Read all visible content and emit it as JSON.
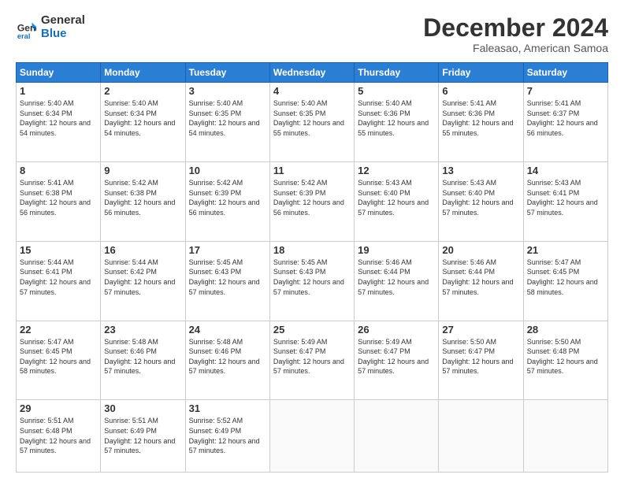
{
  "header": {
    "logo_line1": "General",
    "logo_line2": "Blue",
    "month_title": "December 2024",
    "location": "Faleasao, American Samoa"
  },
  "weekdays": [
    "Sunday",
    "Monday",
    "Tuesday",
    "Wednesday",
    "Thursday",
    "Friday",
    "Saturday"
  ],
  "weeks": [
    [
      {
        "day": 1,
        "sunrise": "5:40 AM",
        "sunset": "6:34 PM",
        "daylight": "12 hours and 54 minutes."
      },
      {
        "day": 2,
        "sunrise": "5:40 AM",
        "sunset": "6:34 PM",
        "daylight": "12 hours and 54 minutes."
      },
      {
        "day": 3,
        "sunrise": "5:40 AM",
        "sunset": "6:35 PM",
        "daylight": "12 hours and 54 minutes."
      },
      {
        "day": 4,
        "sunrise": "5:40 AM",
        "sunset": "6:35 PM",
        "daylight": "12 hours and 55 minutes."
      },
      {
        "day": 5,
        "sunrise": "5:40 AM",
        "sunset": "6:36 PM",
        "daylight": "12 hours and 55 minutes."
      },
      {
        "day": 6,
        "sunrise": "5:41 AM",
        "sunset": "6:36 PM",
        "daylight": "12 hours and 55 minutes."
      },
      {
        "day": 7,
        "sunrise": "5:41 AM",
        "sunset": "6:37 PM",
        "daylight": "12 hours and 56 minutes."
      }
    ],
    [
      {
        "day": 8,
        "sunrise": "5:41 AM",
        "sunset": "6:38 PM",
        "daylight": "12 hours and 56 minutes."
      },
      {
        "day": 9,
        "sunrise": "5:42 AM",
        "sunset": "6:38 PM",
        "daylight": "12 hours and 56 minutes."
      },
      {
        "day": 10,
        "sunrise": "5:42 AM",
        "sunset": "6:39 PM",
        "daylight": "12 hours and 56 minutes."
      },
      {
        "day": 11,
        "sunrise": "5:42 AM",
        "sunset": "6:39 PM",
        "daylight": "12 hours and 56 minutes."
      },
      {
        "day": 12,
        "sunrise": "5:43 AM",
        "sunset": "6:40 PM",
        "daylight": "12 hours and 57 minutes."
      },
      {
        "day": 13,
        "sunrise": "5:43 AM",
        "sunset": "6:40 PM",
        "daylight": "12 hours and 57 minutes."
      },
      {
        "day": 14,
        "sunrise": "5:43 AM",
        "sunset": "6:41 PM",
        "daylight": "12 hours and 57 minutes."
      }
    ],
    [
      {
        "day": 15,
        "sunrise": "5:44 AM",
        "sunset": "6:41 PM",
        "daylight": "12 hours and 57 minutes."
      },
      {
        "day": 16,
        "sunrise": "5:44 AM",
        "sunset": "6:42 PM",
        "daylight": "12 hours and 57 minutes."
      },
      {
        "day": 17,
        "sunrise": "5:45 AM",
        "sunset": "6:43 PM",
        "daylight": "12 hours and 57 minutes."
      },
      {
        "day": 18,
        "sunrise": "5:45 AM",
        "sunset": "6:43 PM",
        "daylight": "12 hours and 57 minutes."
      },
      {
        "day": 19,
        "sunrise": "5:46 AM",
        "sunset": "6:44 PM",
        "daylight": "12 hours and 57 minutes."
      },
      {
        "day": 20,
        "sunrise": "5:46 AM",
        "sunset": "6:44 PM",
        "daylight": "12 hours and 57 minutes."
      },
      {
        "day": 21,
        "sunrise": "5:47 AM",
        "sunset": "6:45 PM",
        "daylight": "12 hours and 58 minutes."
      }
    ],
    [
      {
        "day": 22,
        "sunrise": "5:47 AM",
        "sunset": "6:45 PM",
        "daylight": "12 hours and 58 minutes."
      },
      {
        "day": 23,
        "sunrise": "5:48 AM",
        "sunset": "6:46 PM",
        "daylight": "12 hours and 57 minutes."
      },
      {
        "day": 24,
        "sunrise": "5:48 AM",
        "sunset": "6:46 PM",
        "daylight": "12 hours and 57 minutes."
      },
      {
        "day": 25,
        "sunrise": "5:49 AM",
        "sunset": "6:47 PM",
        "daylight": "12 hours and 57 minutes."
      },
      {
        "day": 26,
        "sunrise": "5:49 AM",
        "sunset": "6:47 PM",
        "daylight": "12 hours and 57 minutes."
      },
      {
        "day": 27,
        "sunrise": "5:50 AM",
        "sunset": "6:47 PM",
        "daylight": "12 hours and 57 minutes."
      },
      {
        "day": 28,
        "sunrise": "5:50 AM",
        "sunset": "6:48 PM",
        "daylight": "12 hours and 57 minutes."
      }
    ],
    [
      {
        "day": 29,
        "sunrise": "5:51 AM",
        "sunset": "6:48 PM",
        "daylight": "12 hours and 57 minutes."
      },
      {
        "day": 30,
        "sunrise": "5:51 AM",
        "sunset": "6:49 PM",
        "daylight": "12 hours and 57 minutes."
      },
      {
        "day": 31,
        "sunrise": "5:52 AM",
        "sunset": "6:49 PM",
        "daylight": "12 hours and 57 minutes."
      },
      null,
      null,
      null,
      null
    ]
  ]
}
